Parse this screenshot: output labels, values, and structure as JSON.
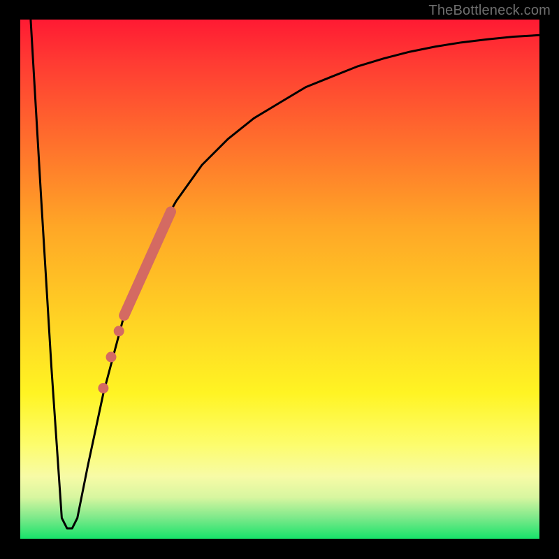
{
  "watermark": "TheBottleneck.com",
  "chart_data": {
    "type": "line",
    "title": "",
    "xlabel": "",
    "ylabel": "",
    "xlim": [
      0,
      100
    ],
    "ylim": [
      0,
      100
    ],
    "grid": false,
    "legend": false,
    "background": {
      "type": "vertical-gradient",
      "stops": [
        {
          "pos": 0,
          "color": "#ff1a33"
        },
        {
          "pos": 8,
          "color": "#ff3a33"
        },
        {
          "pos": 22,
          "color": "#ff6a2d"
        },
        {
          "pos": 40,
          "color": "#ffa726"
        },
        {
          "pos": 58,
          "color": "#ffd324"
        },
        {
          "pos": 72,
          "color": "#fff423"
        },
        {
          "pos": 82,
          "color": "#fdfd6e"
        },
        {
          "pos": 88,
          "color": "#f7fba6"
        },
        {
          "pos": 92,
          "color": "#d8f6a0"
        },
        {
          "pos": 96,
          "color": "#7ce98a"
        },
        {
          "pos": 100,
          "color": "#17e36a"
        }
      ]
    },
    "series": [
      {
        "name": "bottleneck-curve",
        "color": "#000000",
        "x": [
          2,
          4,
          6,
          8,
          9,
          10,
          11,
          13,
          16,
          20,
          25,
          30,
          35,
          40,
          45,
          50,
          55,
          60,
          65,
          70,
          75,
          80,
          85,
          90,
          95,
          100
        ],
        "y": [
          100,
          66,
          33,
          4,
          2,
          2,
          4,
          14,
          28,
          43,
          56,
          65,
          72,
          77,
          81,
          84,
          87,
          89,
          91,
          92.5,
          93.8,
          94.8,
          95.6,
          96.2,
          96.7,
          97
        ]
      }
    ],
    "highlight_segment": {
      "name": "salmon-thick-segment",
      "color": "#d46a62",
      "x": [
        20,
        29
      ],
      "y": [
        43,
        63
      ]
    },
    "highlight_dots": {
      "name": "salmon-dots",
      "color": "#d46a62",
      "points": [
        {
          "x": 19.0,
          "y": 40
        },
        {
          "x": 17.5,
          "y": 35
        },
        {
          "x": 16.0,
          "y": 29
        }
      ]
    }
  }
}
